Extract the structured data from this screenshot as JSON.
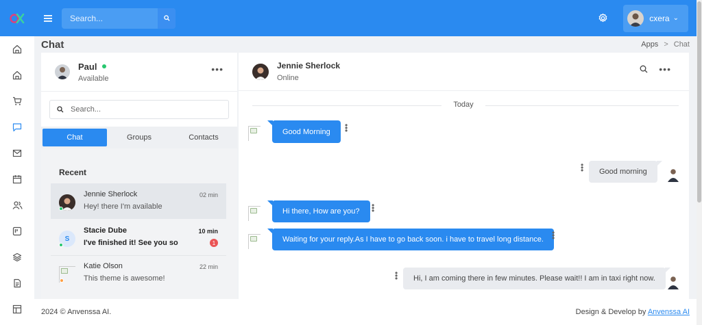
{
  "topbar": {
    "search_placeholder": "Search...",
    "user_name": "cxera",
    "user_caret": "⌄"
  },
  "page": {
    "title": "Chat",
    "breadcrumb": [
      "Apps",
      "Chat"
    ],
    "breadcrumb_sep": ">"
  },
  "profile": {
    "name": "Paul",
    "status": "Available",
    "more": "•••"
  },
  "left": {
    "search_placeholder": "Search...",
    "tabs": [
      "Chat",
      "Groups",
      "Contacts"
    ],
    "recent_label": "Recent",
    "conversations": [
      {
        "name": "Jennie Sherlock",
        "message": "Hey! there I'm available",
        "time": "02 min",
        "status_color": "#28c76f"
      },
      {
        "name": "Stacie Dube",
        "message": "I've finished it! See you so",
        "time": "10 min",
        "initial": "S",
        "badge": "1",
        "status_color": "#28c76f"
      },
      {
        "name": "Katie Olson",
        "message": "This theme is awesome!",
        "time": "22 min",
        "status_color": "#ff9f43"
      }
    ]
  },
  "chat": {
    "contact_name": "Jennie Sherlock",
    "contact_status": "Online",
    "more": "•••",
    "day_label": "Today",
    "messages": [
      {
        "dir": "in",
        "text": "Good Morning"
      },
      {
        "dir": "out",
        "text": "Good morning"
      },
      {
        "dir": "in",
        "text": "Hi there, How are you?"
      },
      {
        "dir": "in",
        "text": "Waiting for your reply.As I have to go back soon. i have to travel long distance."
      },
      {
        "dir": "out",
        "text": "Hi, I am coming there in few minutes. Please wait!! I am in taxi right now."
      }
    ]
  },
  "footer": {
    "copyright": "2024 © Anvenssa AI.",
    "credit_prefix": "Design & Develop by",
    "credit_link": "Anvenssa AI"
  },
  "colors": {
    "primary": "#2a8af0",
    "online": "#28c76f",
    "away": "#ff9f43",
    "badge": "#ea5455"
  }
}
